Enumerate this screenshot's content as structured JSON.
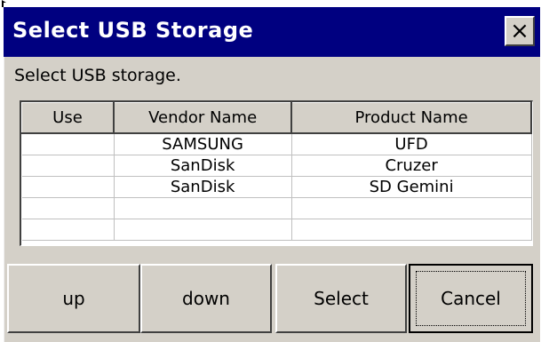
{
  "window": {
    "title": "Select USB Storage",
    "close_label": "×"
  },
  "prompt": "Select USB storage.",
  "table": {
    "headers": [
      "Use",
      "Vendor Name",
      "Product Name"
    ],
    "rows": [
      [
        "",
        "SAMSUNG",
        "UFD"
      ],
      [
        "",
        "SanDisk",
        "Cruzer"
      ],
      [
        "",
        "SanDisk",
        "SD  Gemini"
      ],
      [
        "",
        "",
        ""
      ],
      [
        "",
        "",
        ""
      ]
    ]
  },
  "buttons": {
    "up": "up",
    "down": "down",
    "select": "Select",
    "cancel": "Cancel"
  },
  "colors": {
    "title_bg": "#000080",
    "face": "#d4d0c8",
    "list_bg": "#ffffff"
  }
}
